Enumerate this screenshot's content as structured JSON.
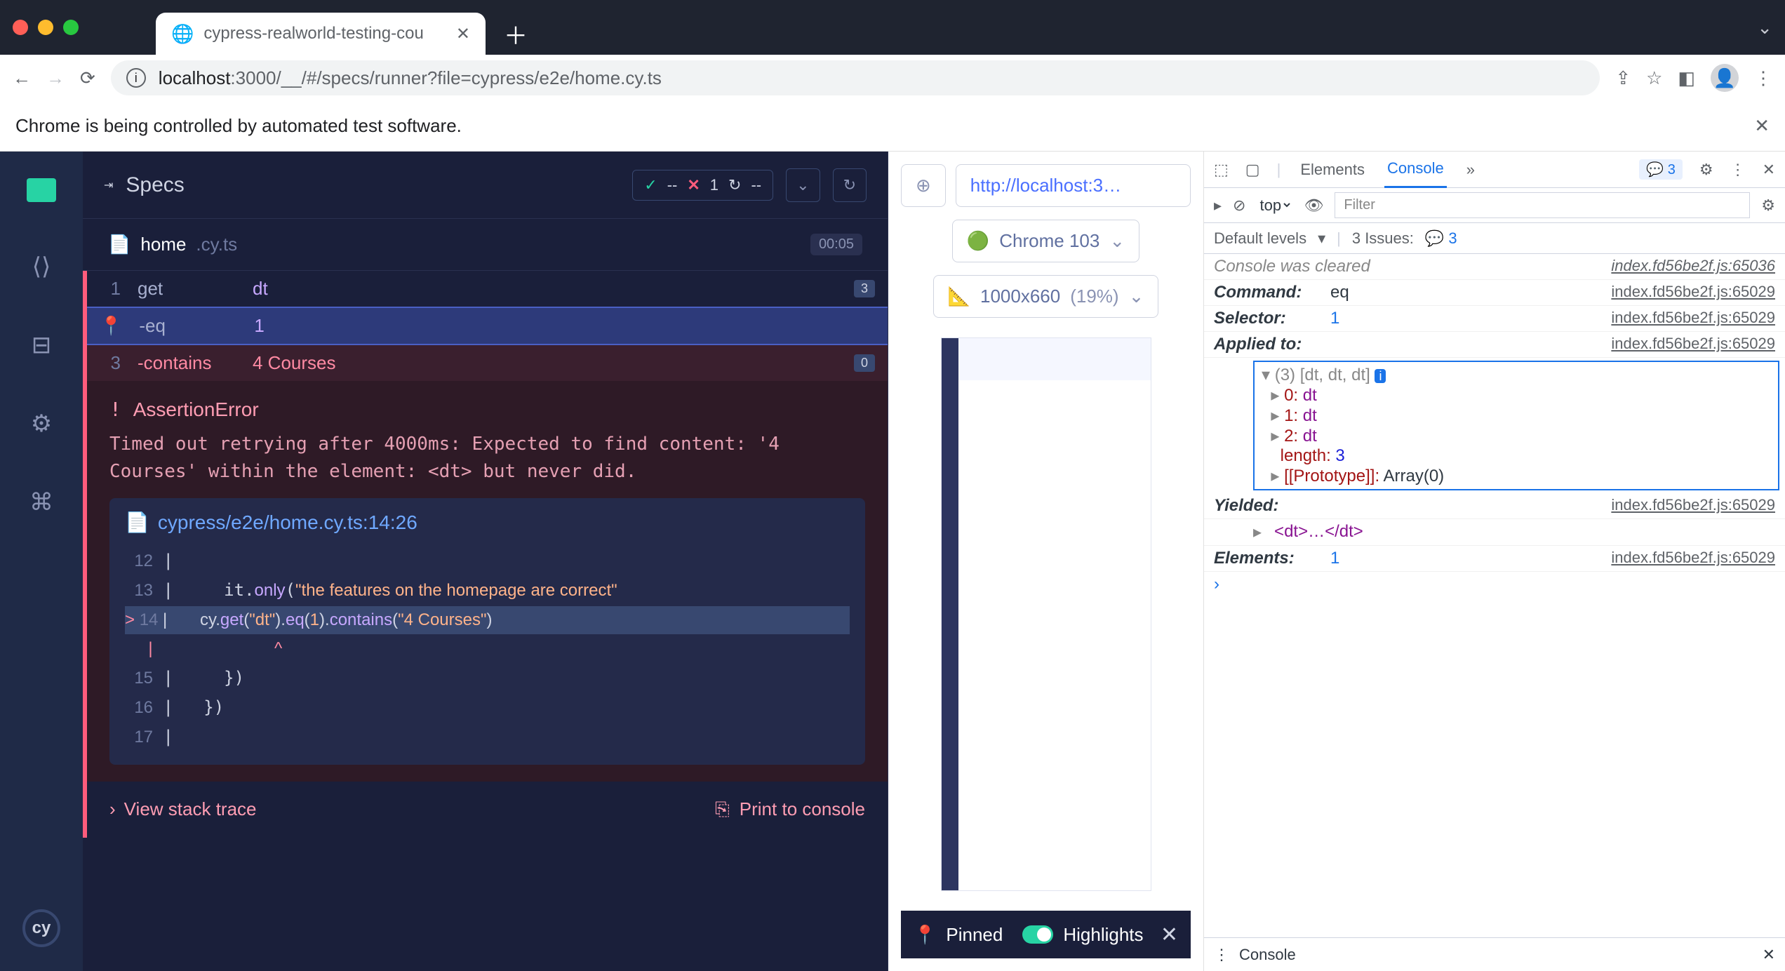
{
  "browser": {
    "tab_title": "cypress-realworld-testing-cou",
    "url_host": "localhost",
    "url_port": ":3000",
    "url_path": "/__/#/specs/runner?file=cypress/e2e/home.cy.ts",
    "infobar": "Chrome is being controlled by automated test software."
  },
  "cypress": {
    "header": "Specs",
    "stats": {
      "pass": "--",
      "fail": "1",
      "pending": "--"
    },
    "file": {
      "name": "home",
      "ext": ".cy.ts",
      "timer": "00:05"
    },
    "commands": [
      {
        "num": "1",
        "op": "get",
        "arg": "dt",
        "badge": "3"
      },
      {
        "num": "",
        "op": "-eq",
        "arg": "1",
        "pinned": true
      },
      {
        "num": "3",
        "op": "-contains",
        "arg": "4 Courses",
        "badge": "0",
        "err": true
      }
    ],
    "error": {
      "title": "AssertionError",
      "message": "Timed out retrying after 4000ms: Expected to find content: '4 Courses' within the element: <dt> but never did.",
      "file_path": "cypress/e2e/home.cy.ts:14:26",
      "code_lines": [
        {
          "ln": "12",
          "txt": ""
        },
        {
          "ln": "13",
          "txt": "    it.only(\"the features on the homepage are correct\""
        },
        {
          "ln": "14",
          "txt": "      cy.get(\"dt\").eq(1).contains(\"4 Courses\")",
          "current": true
        },
        {
          "ln": "",
          "txt": "                         ^",
          "caret": true
        },
        {
          "ln": "15",
          "txt": "    })"
        },
        {
          "ln": "16",
          "txt": "  })"
        },
        {
          "ln": "17",
          "txt": ""
        }
      ],
      "view_stack": "View stack trace",
      "print_console": "Print to console"
    },
    "preview": {
      "url": "http://localhost:3…",
      "browser_label": "Chrome 103",
      "viewport": "1000x660",
      "zoom": "(19%)",
      "pinned_label": "Pinned",
      "highlights_label": "Highlights"
    }
  },
  "devtools": {
    "tabs": {
      "elements": "Elements",
      "console": "Console",
      "more": "»",
      "err_count": "3"
    },
    "sub": {
      "context": "top",
      "filter_placeholder": "Filter",
      "levels": "Default levels",
      "issues": "3 Issues:",
      "issues_count": "3"
    },
    "rows": {
      "cleared": "Console was cleared",
      "command": {
        "k": "Command:",
        "v": "eq"
      },
      "selector": {
        "k": "Selector:",
        "v": "1"
      },
      "applied": {
        "k": "Applied to:"
      },
      "applied_header": "(3) [dt, dt, dt]",
      "applied_items": [
        {
          "k": "0:",
          "v": "dt"
        },
        {
          "k": "1:",
          "v": "dt"
        },
        {
          "k": "2:",
          "v": "dt"
        }
      ],
      "length_k": "length:",
      "length_v": "3",
      "proto_k": "[[Prototype]]:",
      "proto_v": "Array(0)",
      "yielded_k": "Yielded:",
      "yielded_v": "<dt>…</dt>",
      "elements": {
        "k": "Elements:",
        "v": "1"
      },
      "srcs": {
        "a": "index.fd56be2f.js:65036",
        "b": "index.fd56be2f.js:65029"
      }
    },
    "footer_label": "Console"
  }
}
